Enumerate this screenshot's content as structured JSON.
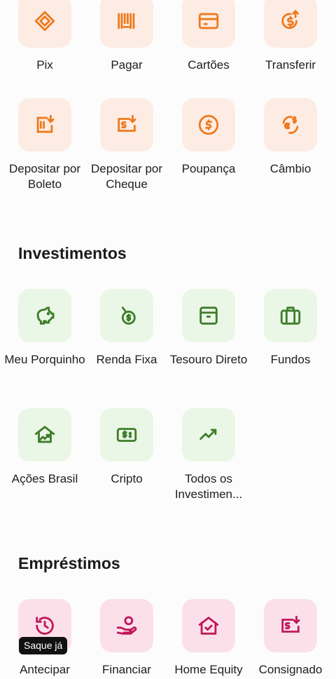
{
  "banking": {
    "items": [
      {
        "label": "Pix",
        "icon": "pix-icon"
      },
      {
        "label": "Pagar",
        "icon": "barcode-icon"
      },
      {
        "label": "Cartões",
        "icon": "credit-card-icon"
      },
      {
        "label": "Transferir",
        "icon": "transfer-money-icon"
      },
      {
        "label": "Depositar por Boleto",
        "icon": "deposit-boleto-icon"
      },
      {
        "label": "Depositar por Cheque",
        "icon": "deposit-cheque-icon"
      },
      {
        "label": "Poupança",
        "icon": "savings-coin-icon"
      },
      {
        "label": "Câmbio",
        "icon": "currency-exchange-icon"
      }
    ]
  },
  "investimentos": {
    "title": "Investimentos",
    "items": [
      {
        "label": "Meu Porquinho",
        "icon": "piggy-bank-icon"
      },
      {
        "label": "Renda Fixa",
        "icon": "fixed-income-icon"
      },
      {
        "label": "Tesouro Direto",
        "icon": "treasury-box-icon"
      },
      {
        "label": "Fundos",
        "icon": "briefcase-icon"
      },
      {
        "label": "Ações Brasil",
        "icon": "stocks-house-icon"
      },
      {
        "label": "Cripto",
        "icon": "crypto-bill-icon"
      },
      {
        "label": "Todos os Investimen...",
        "icon": "trend-up-icon"
      }
    ]
  },
  "emprestimos": {
    "title": "Empréstimos",
    "badge": "Saque já",
    "items": [
      {
        "label": "Antecipar",
        "icon": "clock-history-icon"
      },
      {
        "label": "Financiar",
        "icon": "hand-money-icon"
      },
      {
        "label": "Home Equity",
        "icon": "house-check-icon"
      },
      {
        "label": "Consignado",
        "icon": "payroll-loan-icon"
      }
    ]
  },
  "colors": {
    "orange": "#ee7a1f",
    "green": "#3e7d2a",
    "pink": "#c0185a"
  }
}
